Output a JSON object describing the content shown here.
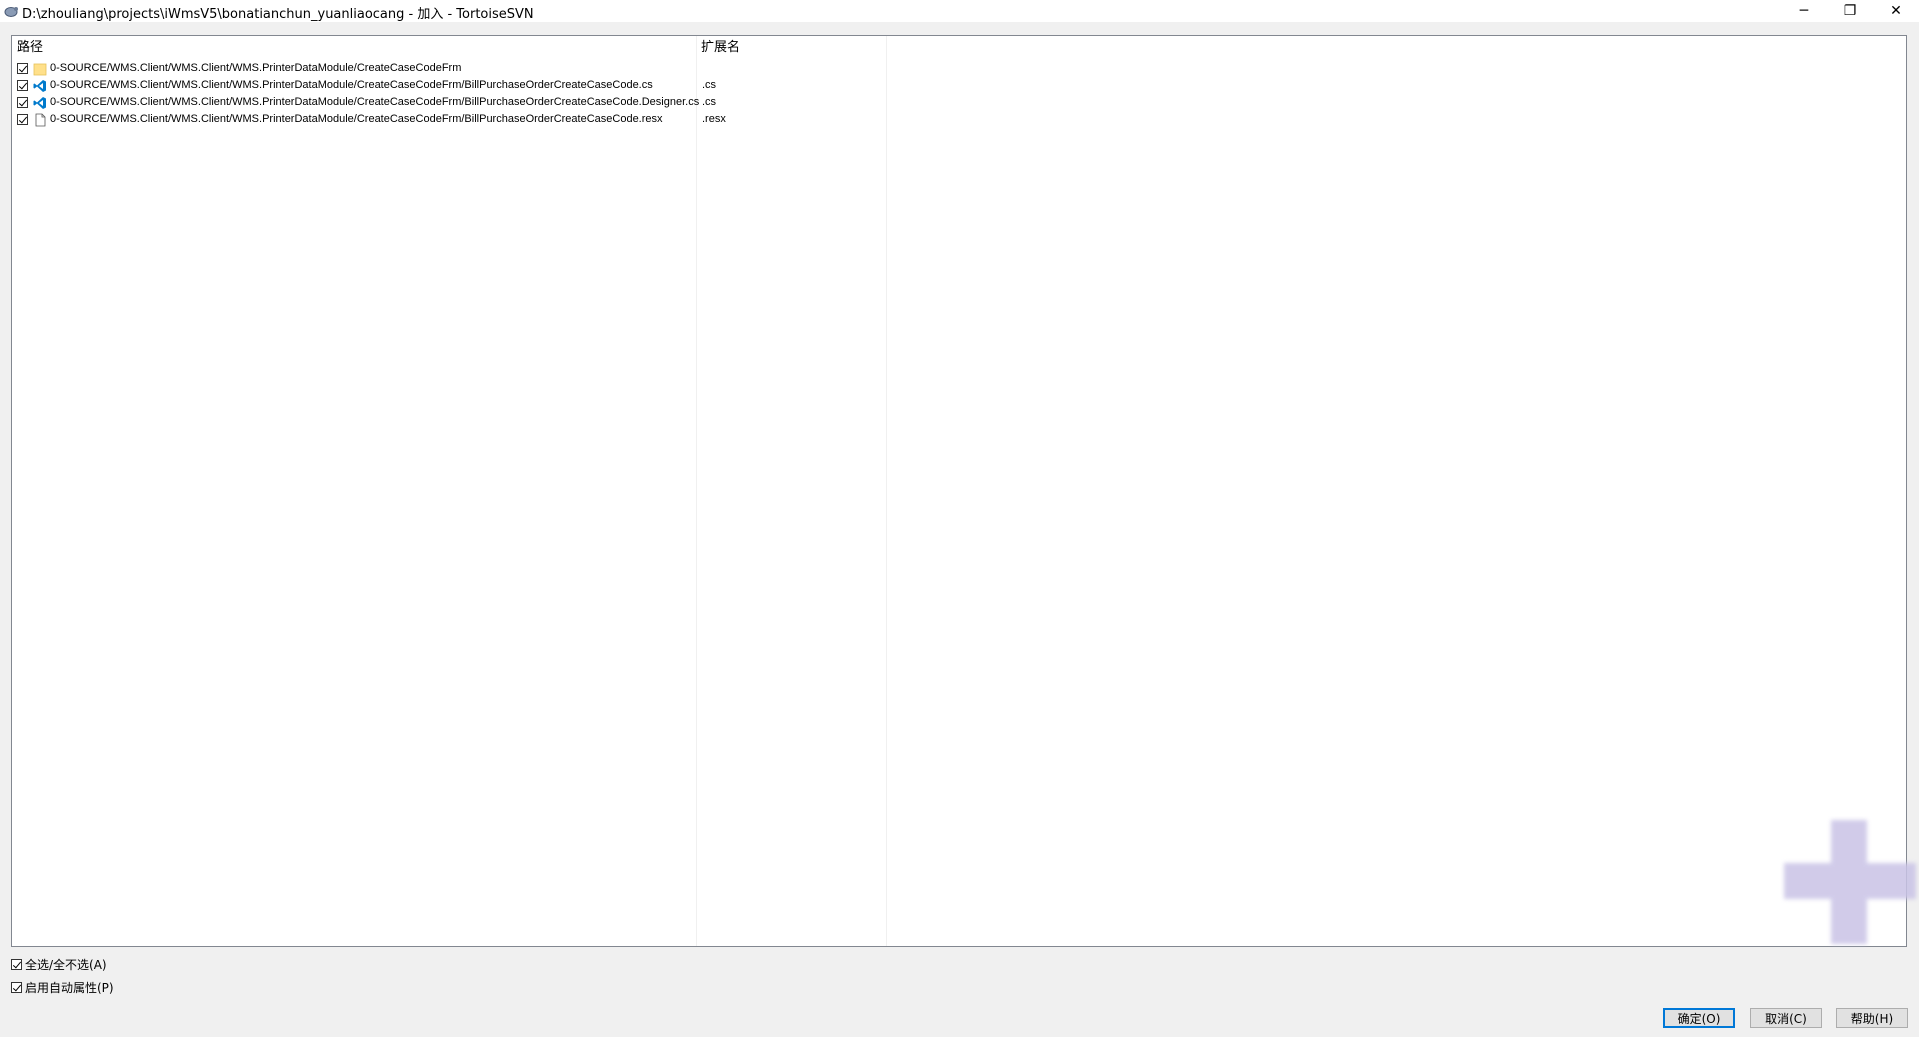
{
  "window": {
    "title": "D:\\zhouliang\\projects\\iWmsV5\\bonatianchun_yuanliaocang - 加入 - TortoiseSVN",
    "minimize": "─",
    "maximize": "❐",
    "close": "✕"
  },
  "list": {
    "columns": {
      "path": "路径",
      "extension": "扩展名"
    },
    "rows": [
      {
        "checked": true,
        "icon": "folder-icon",
        "path": "0-SOURCE/WMS.Client/WMS.Client/WMS.PrinterDataModule/CreateCaseCodeFrm",
        "ext": ""
      },
      {
        "checked": true,
        "icon": "vscode-file-icon",
        "path": "0-SOURCE/WMS.Client/WMS.Client/WMS.PrinterDataModule/CreateCaseCodeFrm/BillPurchaseOrderCreateCaseCode.cs",
        "ext": ".cs"
      },
      {
        "checked": true,
        "icon": "vscode-file-icon",
        "path": "0-SOURCE/WMS.Client/WMS.Client/WMS.PrinterDataModule/CreateCaseCodeFrm/BillPurchaseOrderCreateCaseCode.Designer.cs",
        "ext": ".cs"
      },
      {
        "checked": true,
        "icon": "generic-file-icon",
        "path": "0-SOURCE/WMS.Client/WMS.Client/WMS.PrinterDataModule/CreateCaseCodeFrm/BillPurchaseOrderCreateCaseCode.resx",
        "ext": ".resx"
      }
    ]
  },
  "options": {
    "select_all": {
      "label": "全选/全不选(A)",
      "checked": true
    },
    "auto_props": {
      "label": "启用自动属性(P)",
      "checked": true
    }
  },
  "buttons": {
    "ok": "确定(O)",
    "cancel": "取消(C)",
    "help": "帮助(H)"
  },
  "colors": {
    "accent": "#0078d7",
    "watermark": "#c9c3e6"
  }
}
